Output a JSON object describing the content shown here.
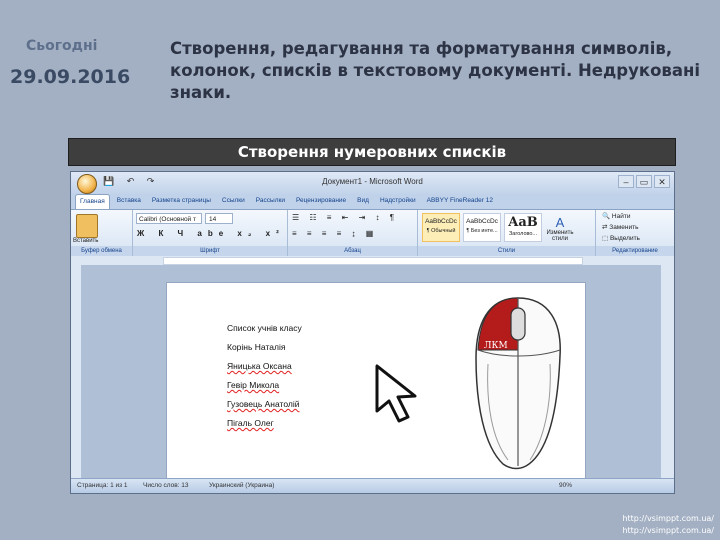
{
  "slide": {
    "date_label": "Сьогодні",
    "date_value": "29.09.2016",
    "title": "Створення, редагування та форматування символів, колонок, списків в текстовому документі. Недруковані знаки.",
    "banner": "Створення нумеровних списків",
    "footer_links": [
      "http://vsimppt.com.ua/",
      "http://vsimppt.com.ua/"
    ]
  },
  "word": {
    "window_title": "Документ1 - Microsoft Word",
    "quick_access": "💾 ↶ ↷",
    "window_controls": [
      "–",
      "▭",
      "✕"
    ],
    "tabs": [
      "Главная",
      "Вставка",
      "Разметка страницы",
      "Ссылки",
      "Рассылки",
      "Рецензирование",
      "Вид",
      "Надстройки",
      "ABBYY FineReader 12"
    ],
    "active_tab": "Главная",
    "groups": {
      "clipboard": {
        "label": "Буфер обмена",
        "paste": "Вставить"
      },
      "font": {
        "label": "Шрифт",
        "font_name": "Calibri (Основной т",
        "font_size": "14",
        "format_buttons": "Ж К Ч abe x₂ x²"
      },
      "paragraph": {
        "label": "Абзац",
        "row1": "☰ ☷ ≡ ⇤ ⇥ ↕ ¶",
        "row2": "≡ ≡ ≡ ≡ ↨ ▦"
      },
      "styles": {
        "label": "Стили",
        "items": [
          {
            "preview": "AaBbCcDc",
            "name": "¶ Обычный"
          },
          {
            "preview": "AaBbCcDc",
            "name": "¶ Без инте..."
          },
          {
            "preview": "AaB",
            "name": "Заголово..."
          }
        ],
        "change_styles": "Изменить стили"
      },
      "editing": {
        "label": "Редактирование",
        "find": "Найти",
        "replace": "Заменить",
        "select": "Выделить"
      }
    },
    "document_lines": [
      "Список учнів класу",
      "Корінь Наталія",
      "Яницька Оксана",
      "Гевір Микола",
      "Гузовець Анатолій",
      "Пігаль Олег"
    ],
    "status": {
      "page": "Страница: 1 из 1",
      "words": "Число слов: 13",
      "language": "Украинский (Украина)",
      "zoom": "90%"
    }
  },
  "mouse": {
    "button_label": "ЛКМ"
  },
  "colors": {
    "slide_bg": "#a3b0c3",
    "banner_bg": "#3e3e3e",
    "mouse_button": "#b41c1c"
  }
}
